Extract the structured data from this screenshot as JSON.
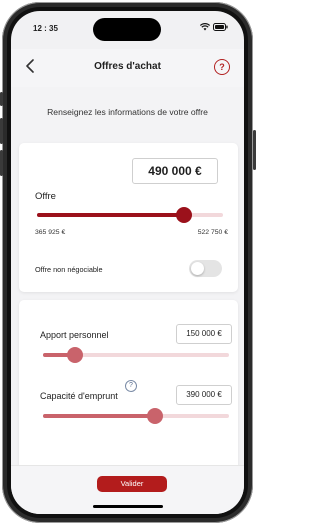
{
  "status_bar": {
    "time": "12 : 35"
  },
  "header": {
    "title": "Offres d'achat",
    "back_label": "‹",
    "help_label": "?"
  },
  "intro_text": "Renseignez les informations de votre offre",
  "offer": {
    "value": "490 000 €",
    "label": "Offre",
    "min_label": "365 925 €",
    "max_label": "522 750 €",
    "slider_fraction": 0.79
  },
  "non_negotiable": {
    "label": "Offre non négociable",
    "enabled": false
  },
  "contribution": {
    "label": "Apport personnel",
    "value": "150 000 €",
    "slider_fraction": 0.17
  },
  "borrowing": {
    "label": "Capacité d'emprunt",
    "info_label": "?",
    "value": "390 000 €",
    "slider_fraction": 0.6
  },
  "footer": {
    "validate_label": "Valider"
  },
  "colors": {
    "accent": "#9b111b",
    "accent_light": "#c9636b",
    "track": "#f2d8db"
  }
}
